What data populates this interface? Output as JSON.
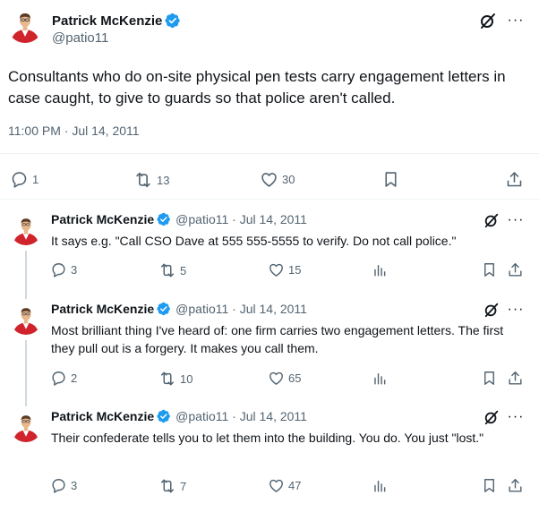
{
  "main_tweet": {
    "name": "Patrick McKenzie",
    "handle": "@patio11",
    "text": "Consultants who do on-site physical pen tests carry engagement letters in case caught, to give to guards so that police aren't called.",
    "timestamp": "11:00 PM · Jul 14, 2011",
    "stats": {
      "replies": "1",
      "retweets": "13",
      "likes": "30"
    }
  },
  "replies": [
    {
      "name": "Patrick McKenzie",
      "meta": "@patio11 · Jul 14, 2011",
      "text": "It says e.g. \"Call CSO Dave at 555 555-5555 to verify.  Do not call police.\"",
      "stats": {
        "replies": "3",
        "retweets": "5",
        "likes": "15"
      }
    },
    {
      "name": "Patrick McKenzie",
      "meta": "@patio11 · Jul 14, 2011",
      "text": "Most brilliant thing I've heard of: one firm carries two engagement letters. The first they pull out is a forgery. It makes you call them.",
      "stats": {
        "replies": "2",
        "retweets": "10",
        "likes": "65"
      }
    },
    {
      "name": "Patrick McKenzie",
      "meta": "@patio11 · Jul 14, 2011",
      "text": "Their confederate tells you to let them into the building. You do. You just \"lost.\"",
      "stats": {
        "replies": "3",
        "retweets": "7",
        "likes": "47"
      }
    }
  ],
  "icons": {
    "verified": "verified-badge-icon",
    "grok": "grok-icon",
    "more": "more-icon",
    "reply": "reply-icon",
    "retweet": "retweet-icon",
    "like": "like-icon",
    "views": "views-icon",
    "bookmark": "bookmark-icon",
    "share": "share-icon"
  },
  "colors": {
    "verified": "#1d9bf0",
    "text": "#0f1419",
    "secondary": "#536471",
    "avatar_red": "#d0232b"
  }
}
